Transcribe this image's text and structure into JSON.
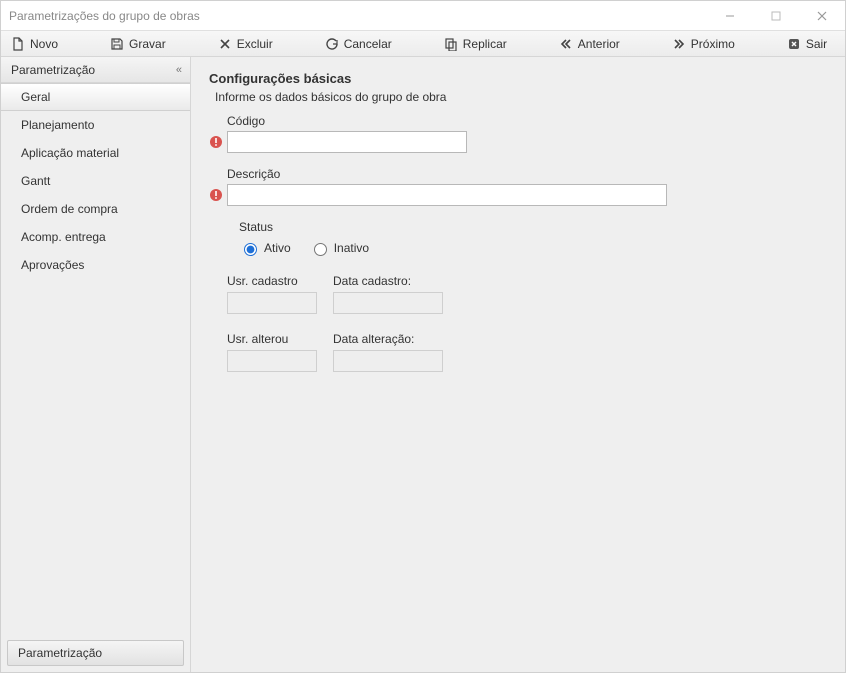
{
  "window": {
    "title": "Parametrizações do grupo de obras"
  },
  "toolbar": {
    "novo": "Novo",
    "gravar": "Gravar",
    "excluir": "Excluir",
    "cancelar": "Cancelar",
    "replicar": "Replicar",
    "anterior": "Anterior",
    "proximo": "Próximo",
    "sair": "Sair"
  },
  "sidebar": {
    "header": "Parametrização",
    "items": [
      {
        "label": "Geral",
        "active": true
      },
      {
        "label": "Planejamento",
        "active": false
      },
      {
        "label": "Aplicação material",
        "active": false
      },
      {
        "label": "Gantt",
        "active": false
      },
      {
        "label": "Ordem de compra",
        "active": false
      },
      {
        "label": "Acomp. entrega",
        "active": false
      },
      {
        "label": "Aprovações",
        "active": false
      }
    ],
    "footer": "Parametrização"
  },
  "form": {
    "heading": "Configurações básicas",
    "subheading": "Informe os dados básicos do grupo de obra",
    "codigo_label": "Código",
    "codigo_value": "",
    "descricao_label": "Descrição",
    "descricao_value": "",
    "status_label": "Status",
    "status_ativo": "Ativo",
    "status_inativo": "Inativo",
    "status_selected": "Ativo",
    "usr_cadastro_label": "Usr. cadastro",
    "data_cadastro_label": "Data cadastro:",
    "usr_alterou_label": "Usr. alterou",
    "data_alteracao_label": "Data alteração:",
    "usr_cadastro_value": "",
    "data_cadastro_value": "",
    "usr_alterou_value": "",
    "data_alteracao_value": ""
  }
}
